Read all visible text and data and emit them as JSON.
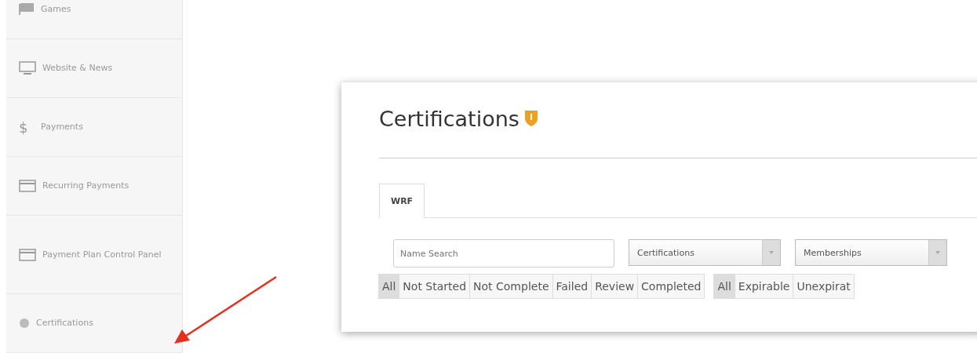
{
  "sidebar": {
    "items": [
      {
        "label": "Games",
        "kind": "flag",
        "selected": false
      },
      {
        "label": "Website & News",
        "kind": "monitor",
        "selected": false
      },
      {
        "label": "Payments",
        "kind": "symbol",
        "symbol": "$",
        "selected": false
      },
      {
        "label": "Recurring Payments",
        "kind": "card",
        "selected": false
      },
      {
        "label": "Payment Plan Control Panel",
        "kind": "card",
        "selected": false
      },
      {
        "label": "Certifications",
        "kind": "dot",
        "selected": false
      }
    ]
  },
  "page": {
    "title": "Certifications",
    "tabs": [
      {
        "label": "WRF",
        "selected": true
      }
    ],
    "search": {
      "placeholder": "Name Search"
    },
    "dropdowns": [
      {
        "value": "Certifications"
      },
      {
        "value": "Memberships"
      }
    ],
    "filter_groups": [
      [
        {
          "label": "All",
          "selected": true
        },
        {
          "label": "Not Started",
          "selected": false
        },
        {
          "label": "Not Complete",
          "selected": false
        },
        {
          "label": "Failed",
          "selected": false
        },
        {
          "label": "Review",
          "selected": false
        },
        {
          "label": "Completed",
          "selected": false
        }
      ],
      [
        {
          "label": "All",
          "selected": true
        },
        {
          "label": "Expirable",
          "selected": false
        },
        {
          "label": "Unexpirat",
          "selected": false
        }
      ]
    ]
  }
}
